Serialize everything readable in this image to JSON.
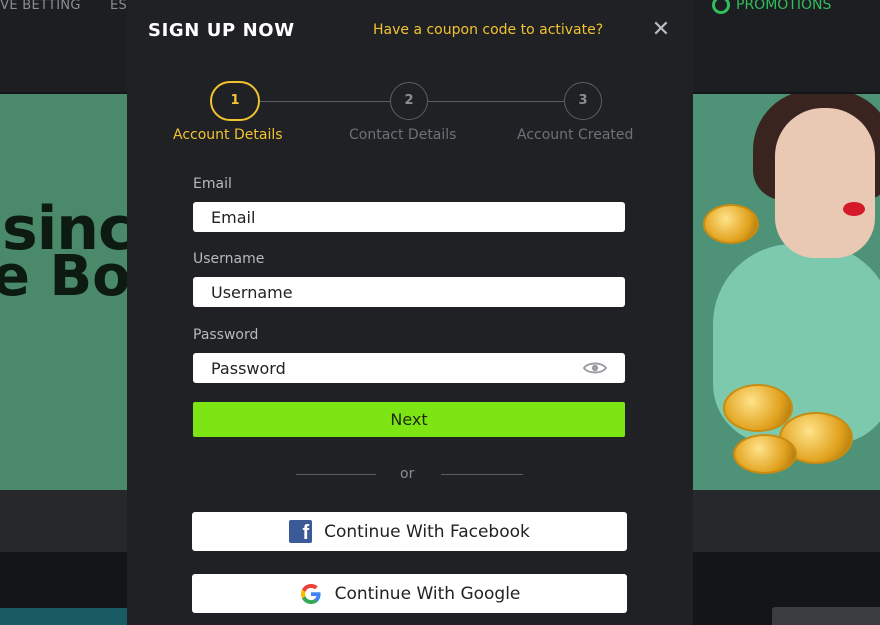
{
  "background": {
    "nav_left": "IVE BETTING",
    "nav_second": "ES",
    "promotions": "PROMOTIONS",
    "banner_text_1": "sinc",
    "banner_text_2": "e Bo"
  },
  "modal": {
    "title": "SIGN UP NOW",
    "coupon_link": "Have a coupon code to activate?",
    "close_symbol": "✕"
  },
  "steps": [
    {
      "number": "1",
      "label": "Account Details",
      "state": "active"
    },
    {
      "number": "2",
      "label": "Contact Details",
      "state": "inactive"
    },
    {
      "number": "3",
      "label": "Account Created",
      "state": "inactive"
    }
  ],
  "form": {
    "email_label": "Email",
    "email_placeholder": "Email",
    "username_label": "Username",
    "username_placeholder": "Username",
    "password_label": "Password",
    "password_placeholder": "Password",
    "next_label": "Next"
  },
  "separator": "or",
  "social": {
    "facebook_label": "Continue With Facebook",
    "google_label": "Continue With Google"
  },
  "colors": {
    "accent_yellow": "#f2c230",
    "next_green": "#7ee514",
    "modal_bg": "#1f2124"
  },
  "icons": [
    "close-icon",
    "eye-icon",
    "facebook-icon",
    "google-icon",
    "promotions-icon"
  ]
}
